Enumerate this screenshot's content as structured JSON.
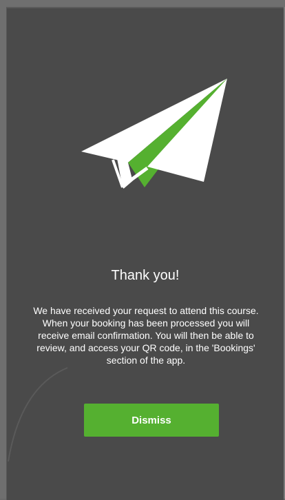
{
  "dialog": {
    "title": "Thank you!",
    "message": "We have received your request to attend this course.  When your booking has been processed you will receive email confirmation. You will then be able to review, and access your QR code, in the 'Bookings' section of the app.",
    "dismiss_label": "Dismiss",
    "icon": "paper-plane-icon"
  },
  "colors": {
    "panel_background": "#4a4a4a",
    "accent_green": "#55b030",
    "plane_white": "#ffffff",
    "text": "#ffffff"
  }
}
